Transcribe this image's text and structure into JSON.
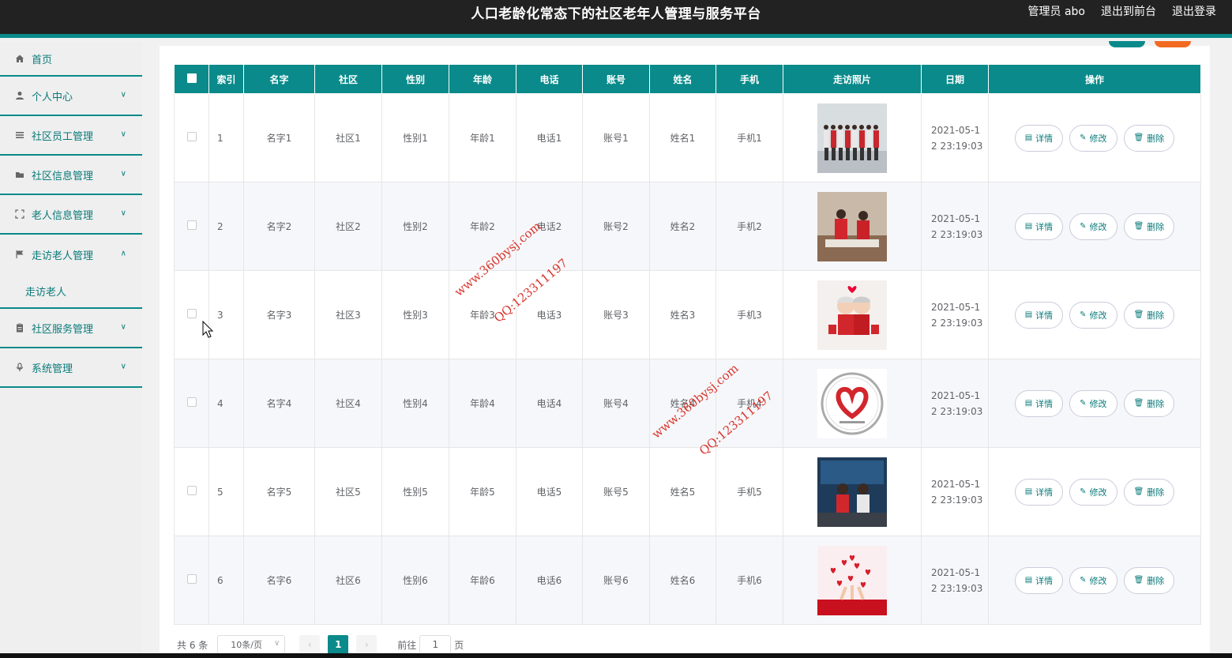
{
  "header": {
    "title": "人口老龄化常态下的社区老年人管理与服务平台",
    "admin_label": "管理员 abo",
    "back_front": "退出到前台",
    "logout": "退出登录"
  },
  "sidebar": {
    "items": [
      {
        "label": "首页",
        "icon": "home-icon"
      },
      {
        "label": "个人中心",
        "icon": "user-icon"
      },
      {
        "label": "社区员工管理",
        "icon": "list-icon"
      },
      {
        "label": "社区信息管理",
        "icon": "folder-icon"
      },
      {
        "label": "老人信息管理",
        "icon": "fullscreen-icon"
      },
      {
        "label": "走访老人管理",
        "icon": "flag-icon"
      },
      {
        "label": "社区服务管理",
        "icon": "clipboard-icon"
      },
      {
        "label": "系统管理",
        "icon": "mic-icon"
      }
    ],
    "submenu": {
      "label": "走访老人"
    }
  },
  "table": {
    "headers": [
      "索引",
      "名字",
      "社区",
      "性别",
      "年龄",
      "电话",
      "账号",
      "姓名",
      "手机",
      "走访照片",
      "日期",
      "操作"
    ],
    "rows": [
      {
        "idx": "1",
        "name": "名字1",
        "community": "社区1",
        "gender": "性别1",
        "age": "年龄1",
        "phone": "电话1",
        "account": "账号1",
        "realname": "姓名1",
        "mobile": "手机1",
        "date1": "2021-05-1",
        "date2": "2 23:19:03"
      },
      {
        "idx": "2",
        "name": "名字2",
        "community": "社区2",
        "gender": "性别2",
        "age": "年龄2",
        "phone": "电话2",
        "account": "账号2",
        "realname": "姓名2",
        "mobile": "手机2",
        "date1": "2021-05-1",
        "date2": "2 23:19:03"
      },
      {
        "idx": "3",
        "name": "名字3",
        "community": "社区3",
        "gender": "性别3",
        "age": "年龄3",
        "phone": "电话3",
        "account": "账号3",
        "realname": "姓名3",
        "mobile": "手机3",
        "date1": "2021-05-1",
        "date2": "2 23:19:03"
      },
      {
        "idx": "4",
        "name": "名字4",
        "community": "社区4",
        "gender": "性别4",
        "age": "年龄4",
        "phone": "电话4",
        "account": "账号4",
        "realname": "姓名4",
        "mobile": "手机4",
        "date1": "2021-05-1",
        "date2": "2 23:19:03"
      },
      {
        "idx": "5",
        "name": "名字5",
        "community": "社区5",
        "gender": "性别5",
        "age": "年龄5",
        "phone": "电话5",
        "account": "账号5",
        "realname": "姓名5",
        "mobile": "手机5",
        "date1": "2021-05-1",
        "date2": "2 23:19:03"
      },
      {
        "idx": "6",
        "name": "名字6",
        "community": "社区6",
        "gender": "性别6",
        "age": "年龄6",
        "phone": "电话6",
        "account": "账号6",
        "realname": "姓名6",
        "mobile": "手机6",
        "date1": "2021-05-1",
        "date2": "2 23:19:03"
      }
    ],
    "ops": {
      "detail": "详情",
      "edit": "修改",
      "delete": "删除"
    }
  },
  "pagination": {
    "total": "共 6 条",
    "page_size": "10条/页",
    "current_page": "1",
    "goto_label": "前往",
    "goto_value": "1",
    "page_suffix": "页"
  },
  "watermark": {
    "site": "www.360bysj.com",
    "qq": "QQ:123311197"
  },
  "colors": {
    "accent": "#0a8a8a",
    "topbar": "#222222",
    "watermark": "#d9342b"
  }
}
